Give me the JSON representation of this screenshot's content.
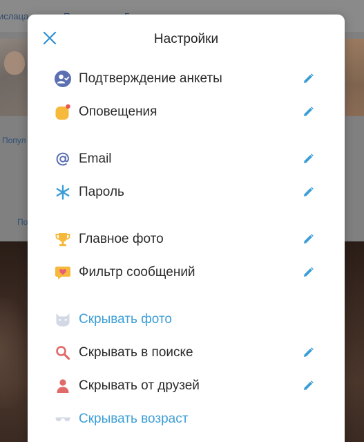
{
  "background": {
    "nav": [
      "ислаца",
      "П",
      "Г..."
    ],
    "links": [
      "Попул",
      "По"
    ]
  },
  "modal": {
    "title": "Настройки",
    "close_icon": "close-icon",
    "items": [
      {
        "label": "Подтверждение анкеты",
        "icon": "verify-user-icon",
        "editable": true,
        "link_style": false
      },
      {
        "label": "Оповещения",
        "icon": "notification-icon",
        "editable": true,
        "link_style": false
      },
      {
        "label": "Email",
        "icon": "at-sign-icon",
        "editable": true,
        "link_style": false
      },
      {
        "label": "Пароль",
        "icon": "asterisk-icon",
        "editable": true,
        "link_style": false
      },
      {
        "label": "Главное фото",
        "icon": "trophy-icon",
        "editable": true,
        "link_style": false
      },
      {
        "label": "Фильтр сообщений",
        "icon": "heart-message-icon",
        "editable": true,
        "link_style": false
      },
      {
        "label": "Скрывать фото",
        "icon": "mask-icon",
        "editable": false,
        "link_style": true
      },
      {
        "label": "Скрывать в поиске",
        "icon": "search-icon",
        "editable": true,
        "link_style": false
      },
      {
        "label": "Скрывать от друзей",
        "icon": "person-icon",
        "editable": true,
        "link_style": false
      },
      {
        "label": "Скрывать возраст",
        "icon": "sunglasses-icon",
        "editable": false,
        "link_style": true
      }
    ]
  },
  "colors": {
    "accent": "#3c9ed6",
    "close": "#2f8fd0",
    "text": "#2b2b2b"
  }
}
